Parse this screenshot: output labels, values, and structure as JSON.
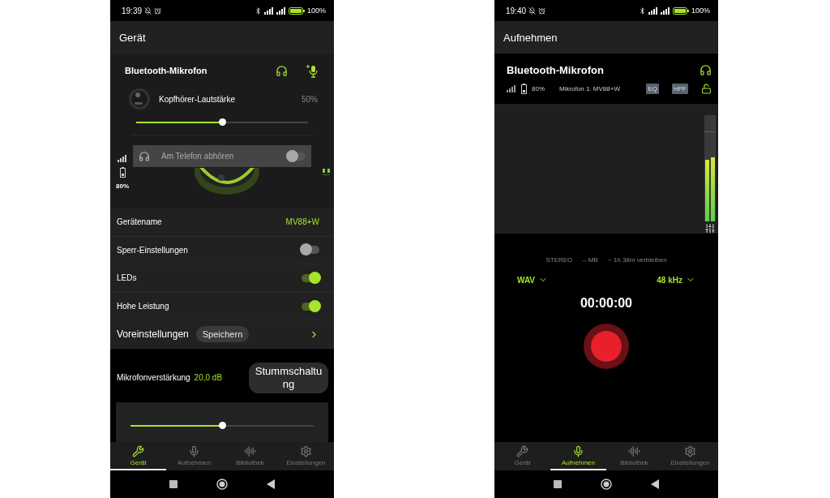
{
  "device_screen": {
    "status_bar": {
      "time": "19:39",
      "battery": "100%"
    },
    "title": "Gerät",
    "device": {
      "name": "Bluetooth-Mikrofon",
      "volume_label": "Kopfhörer-Lautstärke",
      "volume_reading": "50%",
      "volume_slider": {
        "level": 0.5
      },
      "battery": "80%",
      "monitor": {
        "label": "Am Telefon abhören",
        "on": false
      }
    },
    "settings": [
      {
        "kind": "value",
        "label": "Gerätename",
        "value": "MV88+W"
      },
      {
        "kind": "toggle",
        "label": "Sperr-Einstellungen",
        "on": false
      },
      {
        "kind": "toggle",
        "label": "LEDs",
        "on": true
      },
      {
        "kind": "toggle",
        "label": "Hohe Leistung",
        "on": true
      },
      {
        "kind": "preset",
        "label": "Voreinstellungen",
        "button": "Speichern"
      }
    ],
    "gain": {
      "label": "Mikrofonverstärkung",
      "reading": "20,0 dB",
      "level": 0.5,
      "mute_button": "Stummschaltung"
    },
    "bottom_nav": [
      {
        "kind": "device",
        "label": "Gerät",
        "selected": true
      },
      {
        "kind": "record",
        "label": "Aufnehmen",
        "selected": false
      },
      {
        "kind": "library",
        "label": "Bibliothek",
        "selected": false
      },
      {
        "kind": "settings",
        "label": "Einstellungen",
        "selected": false
      }
    ]
  },
  "record_screen": {
    "status_bar": {
      "time": "19:40",
      "battery": "100%"
    },
    "title": "Aufnehmen",
    "device": {
      "name": "Bluetooth-Mikrofon",
      "battery": "80%",
      "mic": "Mikrofon 1: MV88+W",
      "badges": [
        "EQ",
        "HPF"
      ]
    },
    "meters": [
      {
        "level": 0.58
      },
      {
        "level": 0.6
      }
    ],
    "info": [
      "STEREO",
      "-- MB",
      "~ 1h 38m verbleiben"
    ],
    "format": "WAV",
    "sample_rate": "48 kHz",
    "timer": "00:00:00",
    "bottom_nav": [
      {
        "kind": "device",
        "label": "Gerät",
        "selected": false
      },
      {
        "kind": "record",
        "label": "Aufnehmen",
        "selected": true
      },
      {
        "kind": "library",
        "label": "Bibliothek",
        "selected": false
      },
      {
        "kind": "settings",
        "label": "Einstellungen",
        "selected": false
      }
    ]
  }
}
